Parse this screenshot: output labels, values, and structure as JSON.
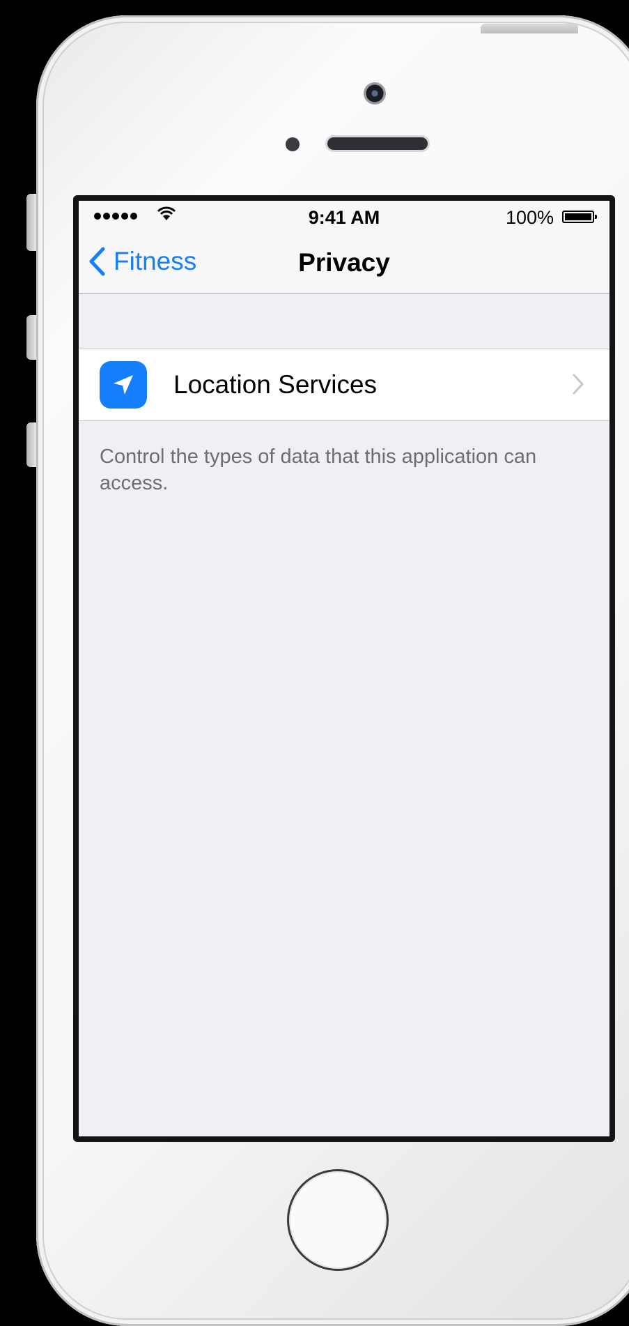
{
  "status_bar": {
    "time": "9:41 AM",
    "battery_percent": "100%",
    "signal_bars": 5,
    "wifi_icon": "wifi-icon"
  },
  "nav": {
    "back_label": "Fitness",
    "title": "Privacy"
  },
  "list": {
    "items": [
      {
        "label": "Location Services",
        "icon": "location-arrow-icon",
        "icon_bg": "#147efb"
      }
    ],
    "footer": "Control the types of data that this application can access."
  },
  "colors": {
    "accent": "#147efb",
    "background": "#efeff4",
    "secondary_text": "#6d6d72"
  }
}
